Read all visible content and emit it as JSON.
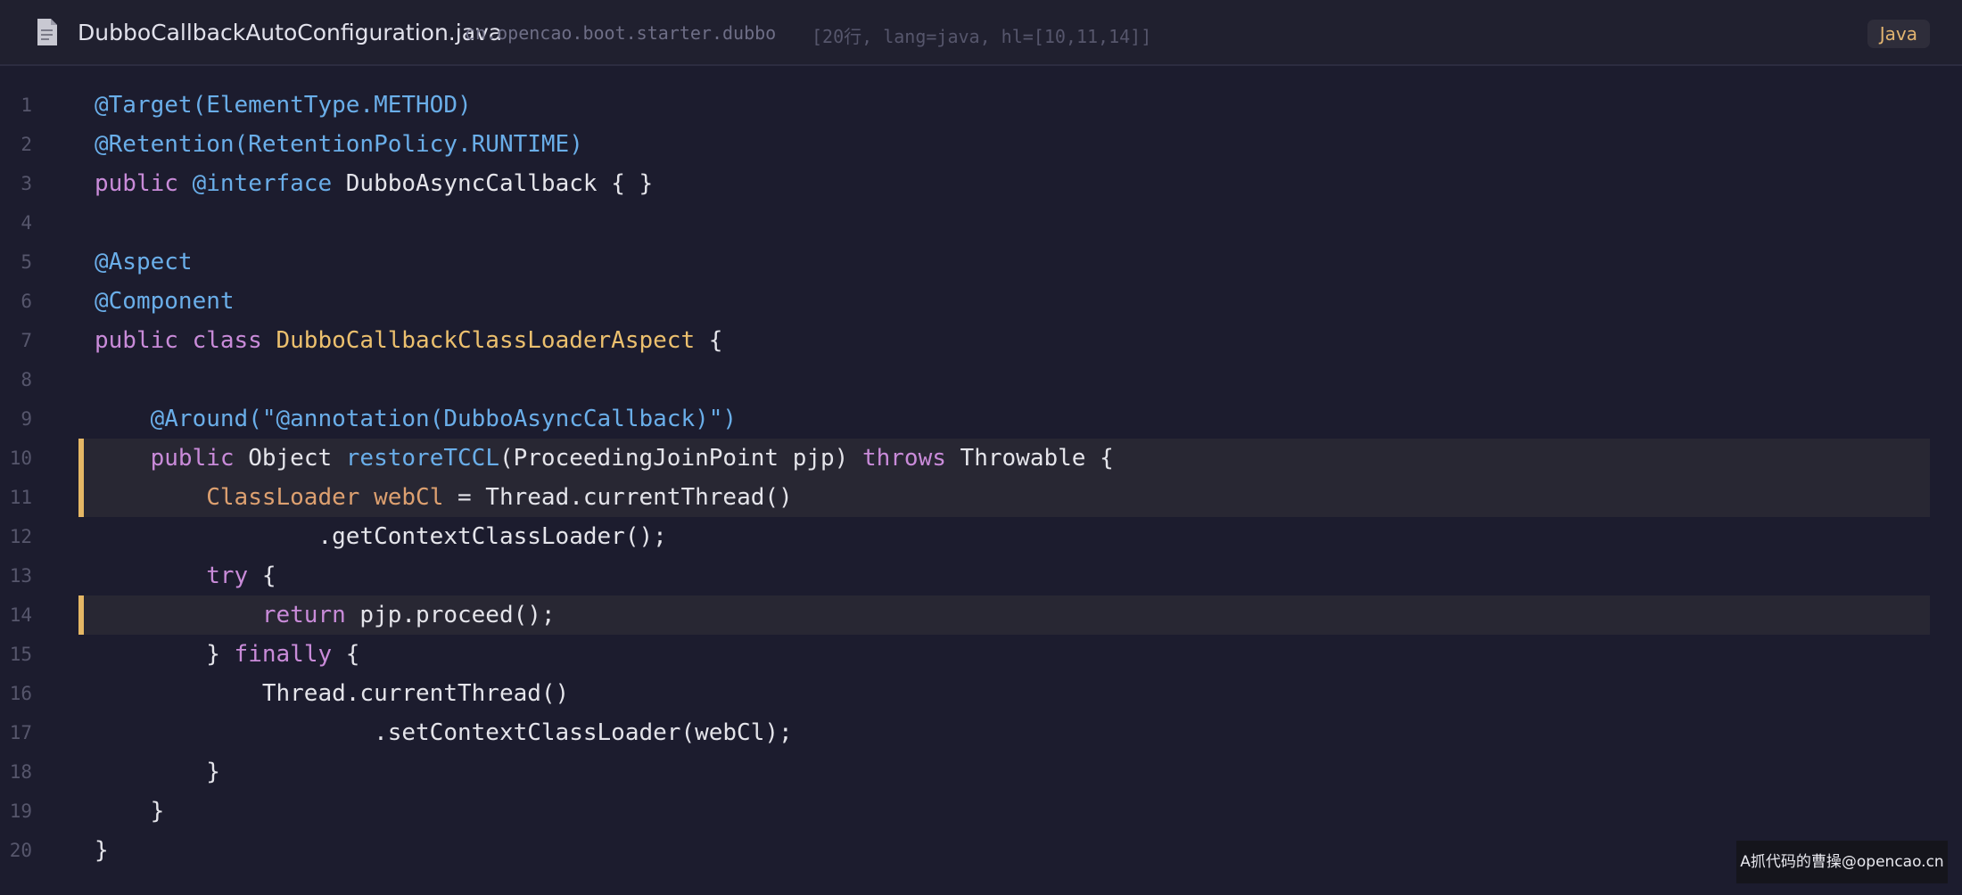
{
  "header": {
    "filename": "DubboCallbackAutoConfiguration.java",
    "package": "cn.opencao.boot.starter.dubbo",
    "meta": "[20行, lang=java, hl=[10,11,14]]",
    "language_badge": "Java",
    "file_icon": "document-icon"
  },
  "code": {
    "highlighted_lines": [
      10,
      11,
      14
    ],
    "lines": [
      {
        "n": "1",
        "tokens": [
          [
            "an",
            "@Target(ElementType.METHOD)"
          ]
        ]
      },
      {
        "n": "2",
        "tokens": [
          [
            "an",
            "@Retention(RetentionPolicy.RUNTIME)"
          ]
        ]
      },
      {
        "n": "3",
        "tokens": [
          [
            "kw",
            "public "
          ],
          [
            "an",
            "@interface"
          ],
          [
            "pl",
            " DubboAsyncCallback { }"
          ]
        ]
      },
      {
        "n": "4",
        "tokens": []
      },
      {
        "n": "5",
        "tokens": [
          [
            "an",
            "@Aspect"
          ]
        ]
      },
      {
        "n": "6",
        "tokens": [
          [
            "an",
            "@Component"
          ]
        ]
      },
      {
        "n": "7",
        "tokens": [
          [
            "kw",
            "public class "
          ],
          [
            "cls",
            "DubboCallbackClassLoaderAspect"
          ],
          [
            "pl",
            " {"
          ]
        ]
      },
      {
        "n": "8",
        "tokens": []
      },
      {
        "n": "9",
        "tokens": [
          [
            "pl",
            "    "
          ],
          [
            "an",
            "@Around(\"@annotation(DubboAsyncCallback)\")"
          ]
        ]
      },
      {
        "n": "10",
        "tokens": [
          [
            "pl",
            "    "
          ],
          [
            "kw",
            "public "
          ],
          [
            "pl",
            "Object "
          ],
          [
            "fn",
            "restoreTCCL"
          ],
          [
            "pl",
            "(ProceedingJoinPoint pjp) "
          ],
          [
            "kw",
            "throws "
          ],
          [
            "pl",
            "Throwable {"
          ]
        ]
      },
      {
        "n": "11",
        "tokens": [
          [
            "pl",
            "        "
          ],
          [
            "var",
            "ClassLoader webCl"
          ],
          [
            "pl",
            " = Thread.currentThread()"
          ]
        ]
      },
      {
        "n": "12",
        "tokens": [
          [
            "pl",
            "                .getContextClassLoader();"
          ]
        ]
      },
      {
        "n": "13",
        "tokens": [
          [
            "pl",
            "        "
          ],
          [
            "kw",
            "try"
          ],
          [
            "pl",
            " {"
          ]
        ]
      },
      {
        "n": "14",
        "tokens": [
          [
            "pl",
            "            "
          ],
          [
            "kw",
            "return "
          ],
          [
            "pl",
            "pjp.proceed();"
          ]
        ]
      },
      {
        "n": "15",
        "tokens": [
          [
            "pl",
            "        } "
          ],
          [
            "kw",
            "finally"
          ],
          [
            "pl",
            " {"
          ]
        ]
      },
      {
        "n": "16",
        "tokens": [
          [
            "pl",
            "            Thread.currentThread()"
          ]
        ]
      },
      {
        "n": "17",
        "tokens": [
          [
            "pl",
            "                    .setContextClassLoader(webCl);"
          ]
        ]
      },
      {
        "n": "18",
        "tokens": [
          [
            "pl",
            "        }"
          ]
        ]
      },
      {
        "n": "19",
        "tokens": [
          [
            "pl",
            "    }"
          ]
        ]
      },
      {
        "n": "20",
        "tokens": [
          [
            "pl",
            "}"
          ]
        ]
      }
    ]
  },
  "watermark": "A抓代码的曹操@opencao.cn",
  "colors": {
    "background": "#1c1c2e",
    "keyword": "#c98bd9",
    "annotation": "#6aaee9",
    "class_name": "#ecc06e",
    "variable": "#dda070",
    "highlight_bar": "#e5b765"
  }
}
